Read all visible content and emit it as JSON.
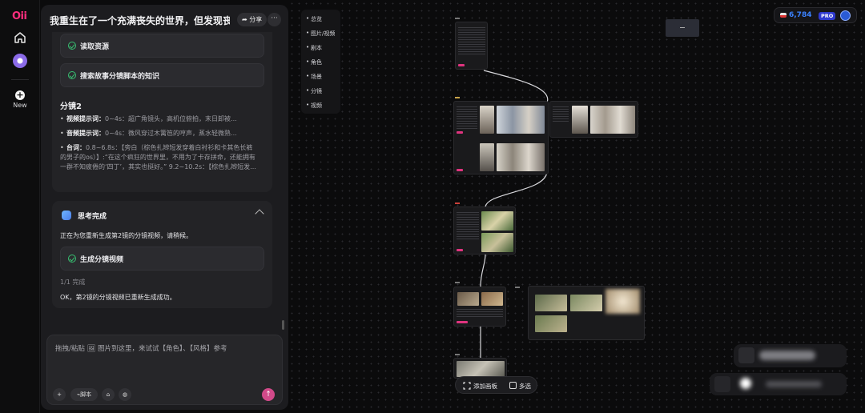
{
  "app": {
    "logo": "Oii",
    "new_label": "New"
  },
  "chat": {
    "title": "我重生在了一个充满丧失的世界，但发现丧...",
    "share_label": "分享",
    "more_label": "···",
    "steps_top": [
      {
        "label": "读取资源"
      },
      {
        "label": "搜索故事分镜脚本的知识"
      }
    ],
    "shot_heading": "分镜2",
    "shot_items": [
      {
        "key": "视频提示词：",
        "text": "0~4s：超广角镜头，高机位俯拍，末日卸被..."
      },
      {
        "key": "音频提示词：",
        "text": "0~4s：微风穿过木篱笆的哼声，蒸水轻微熟..."
      },
      {
        "key": "台词：",
        "text": "0.8~6.8s：【旁白（棕色扎辫短发穿着白衬衫和卡其色长裤的男子的os）】:“在这个疯狂的世界里，不用为了卡存拼命，还能拥有一群不知疲倦的‘四丁’，其实也挺好。” 9.2~10.2s：【棕色扎辫短发..."
      }
    ],
    "thinking": {
      "title": "思考完成",
      "status": "正在为您重新生成第2镜的分镜视频，请稍候。",
      "step_label": "生成分镜视频",
      "progress": "1/1 完成",
      "result": "OK，第2镜的分镜视频已重新生成成功。"
    },
    "input": {
      "placeholder": "拖拽/粘贴 🖼 图片到这里，来试试【角色】、【风格】参考",
      "tool_add": "+",
      "tool_script": "脚本",
      "send": "↑"
    }
  },
  "canvas": {
    "nav_items": [
      "总览",
      "图片/视频",
      "剧本",
      "角色",
      "场景",
      "分镜",
      "视频"
    ],
    "credits": {
      "value": "6,784",
      "plan": "PRO"
    },
    "bottom_bar": {
      "add_board": "添加画板",
      "multi_select": "多选"
    }
  }
}
